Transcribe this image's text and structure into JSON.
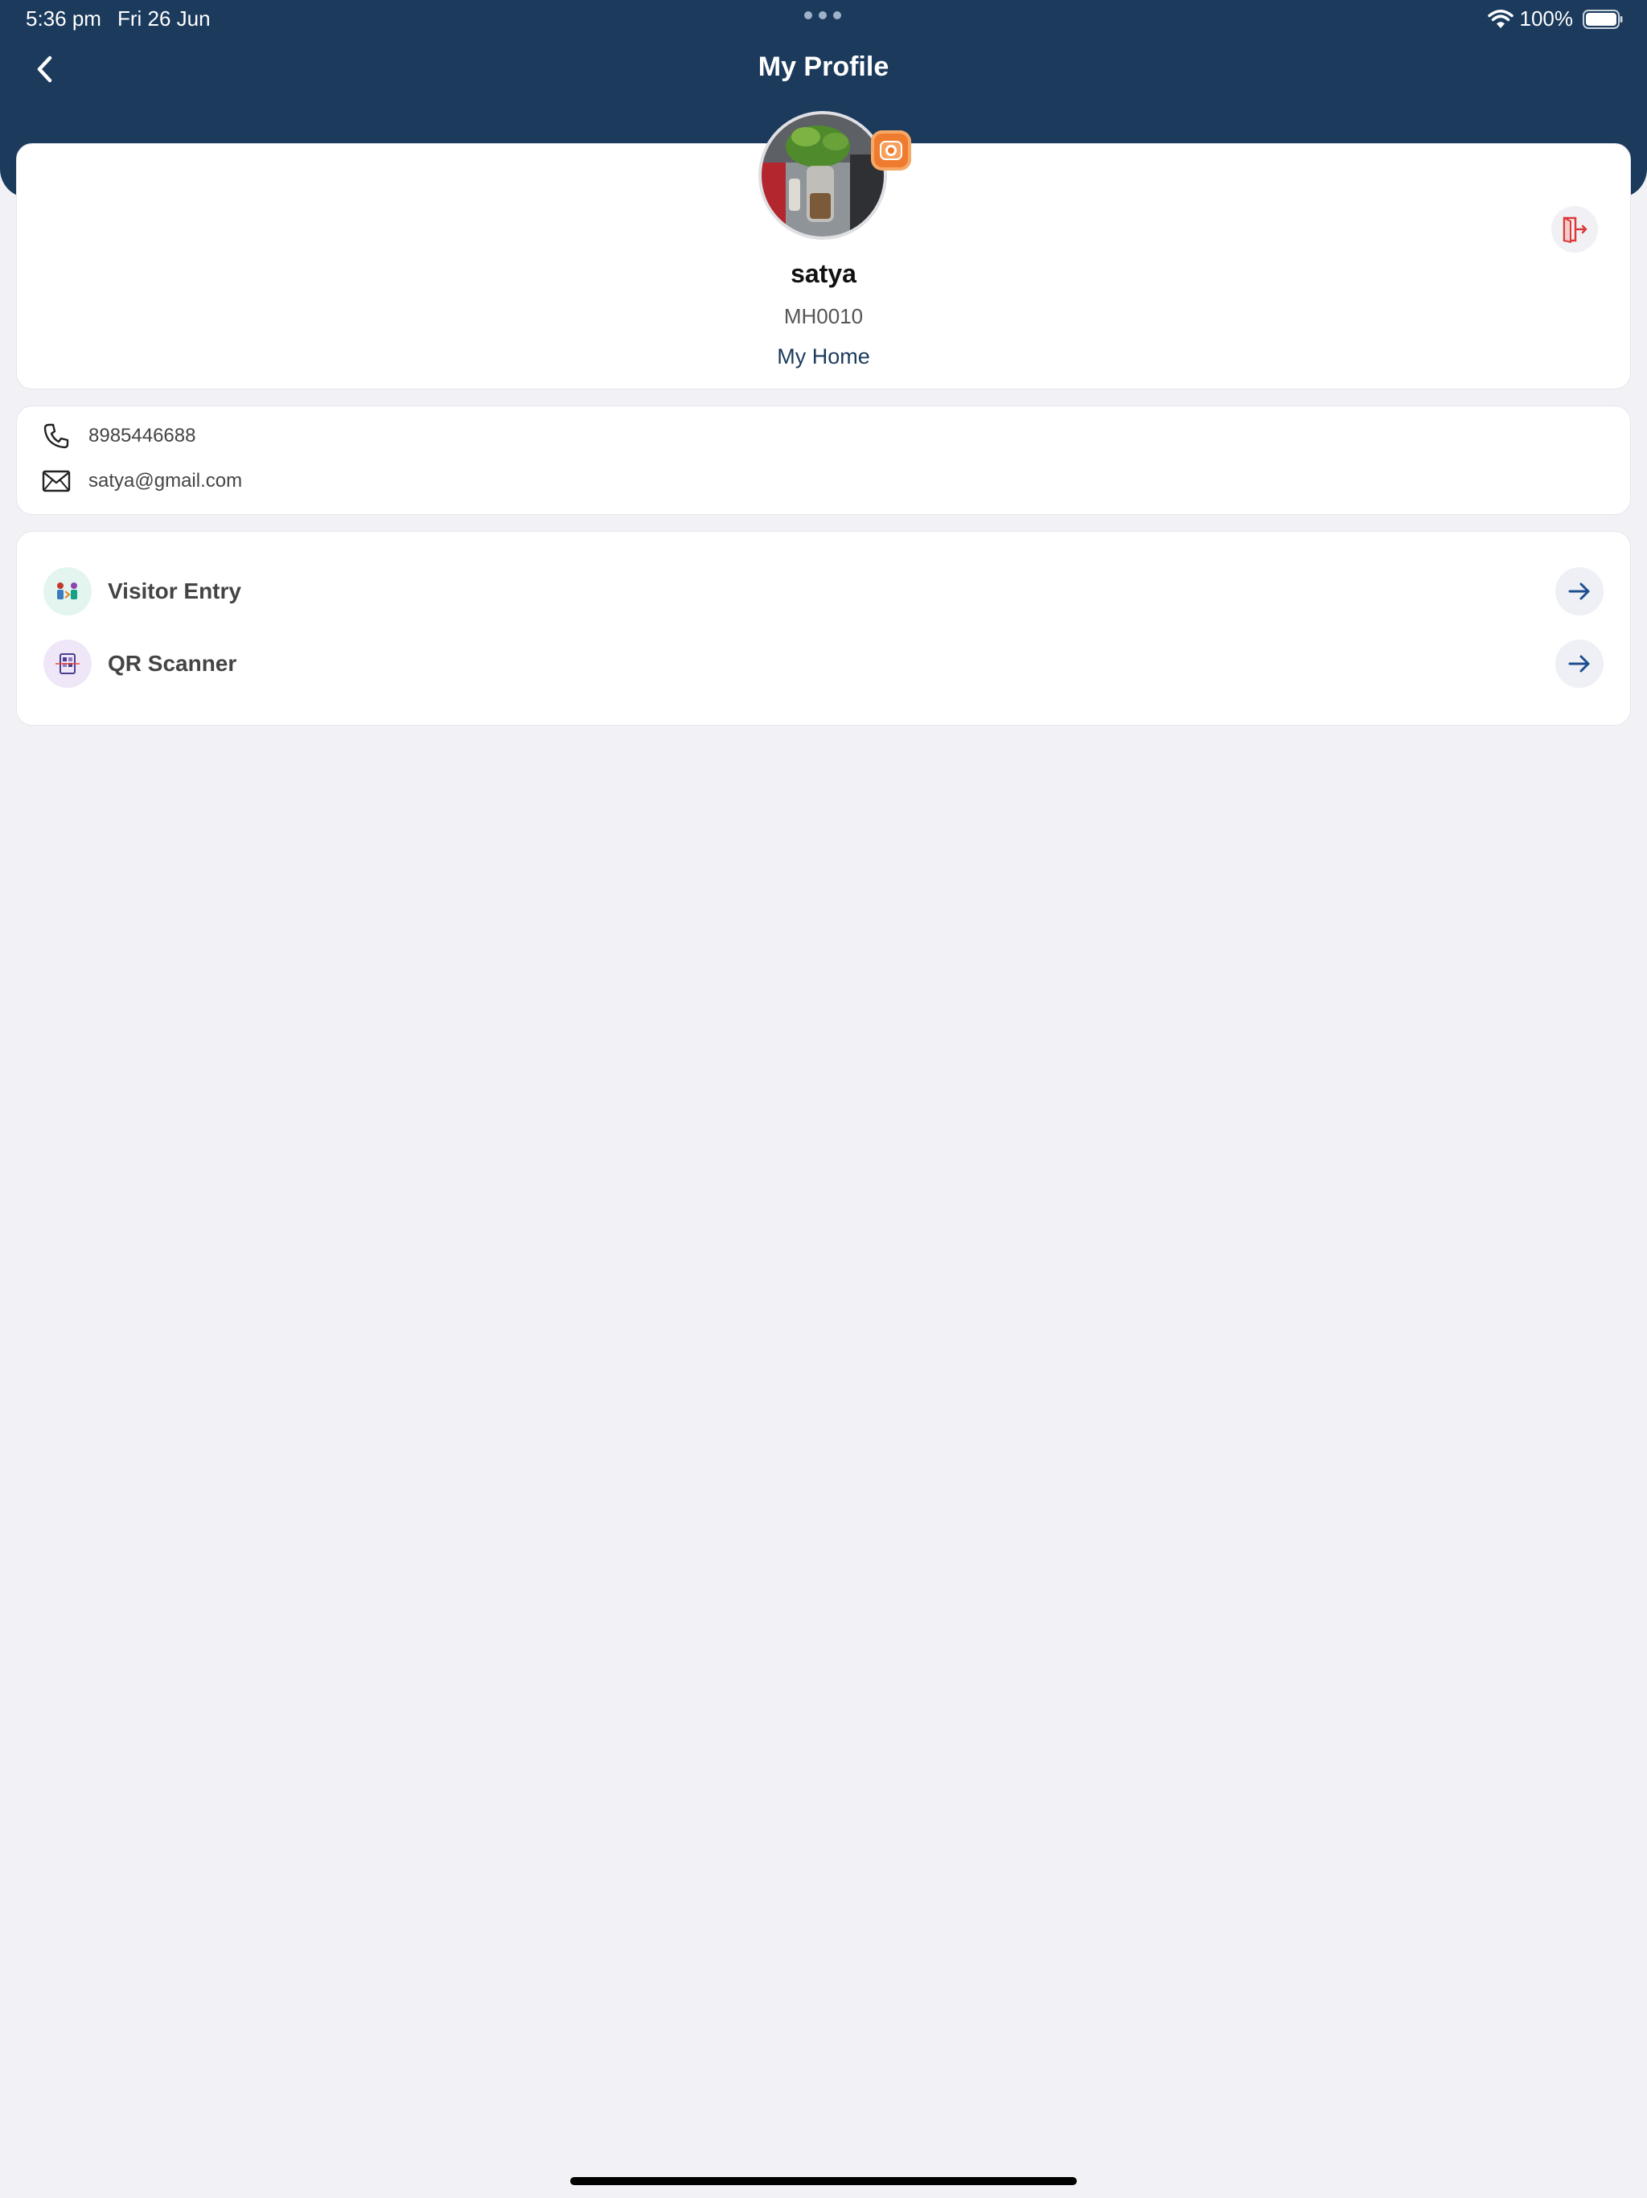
{
  "status_bar": {
    "time": "5:36 pm",
    "date": "Fri 26 Jun",
    "battery": "100%",
    "icons": [
      "wifi-icon",
      "battery-icon"
    ]
  },
  "header": {
    "title": "My Profile",
    "back_icon": "chevron-left-icon",
    "background_color": "#1b3a5c"
  },
  "profile": {
    "name": "satya",
    "code": "MH0010",
    "home": "My Home",
    "camera_icon": "camera-icon",
    "logout_icon": "logout-icon",
    "accent_color": "#ef7b2e",
    "logout_color": "#d93a3a"
  },
  "contact": {
    "phone": "8985446688",
    "email": "satya@gmail.com",
    "phone_icon": "phone-icon",
    "email_icon": "mail-icon"
  },
  "menu": {
    "items": [
      {
        "label": "Visitor Entry",
        "icon": "visitor-entry-icon",
        "arrow_icon": "arrow-right-icon"
      },
      {
        "label": "QR Scanner",
        "icon": "qr-scanner-icon",
        "arrow_icon": "arrow-right-icon"
      }
    ]
  }
}
